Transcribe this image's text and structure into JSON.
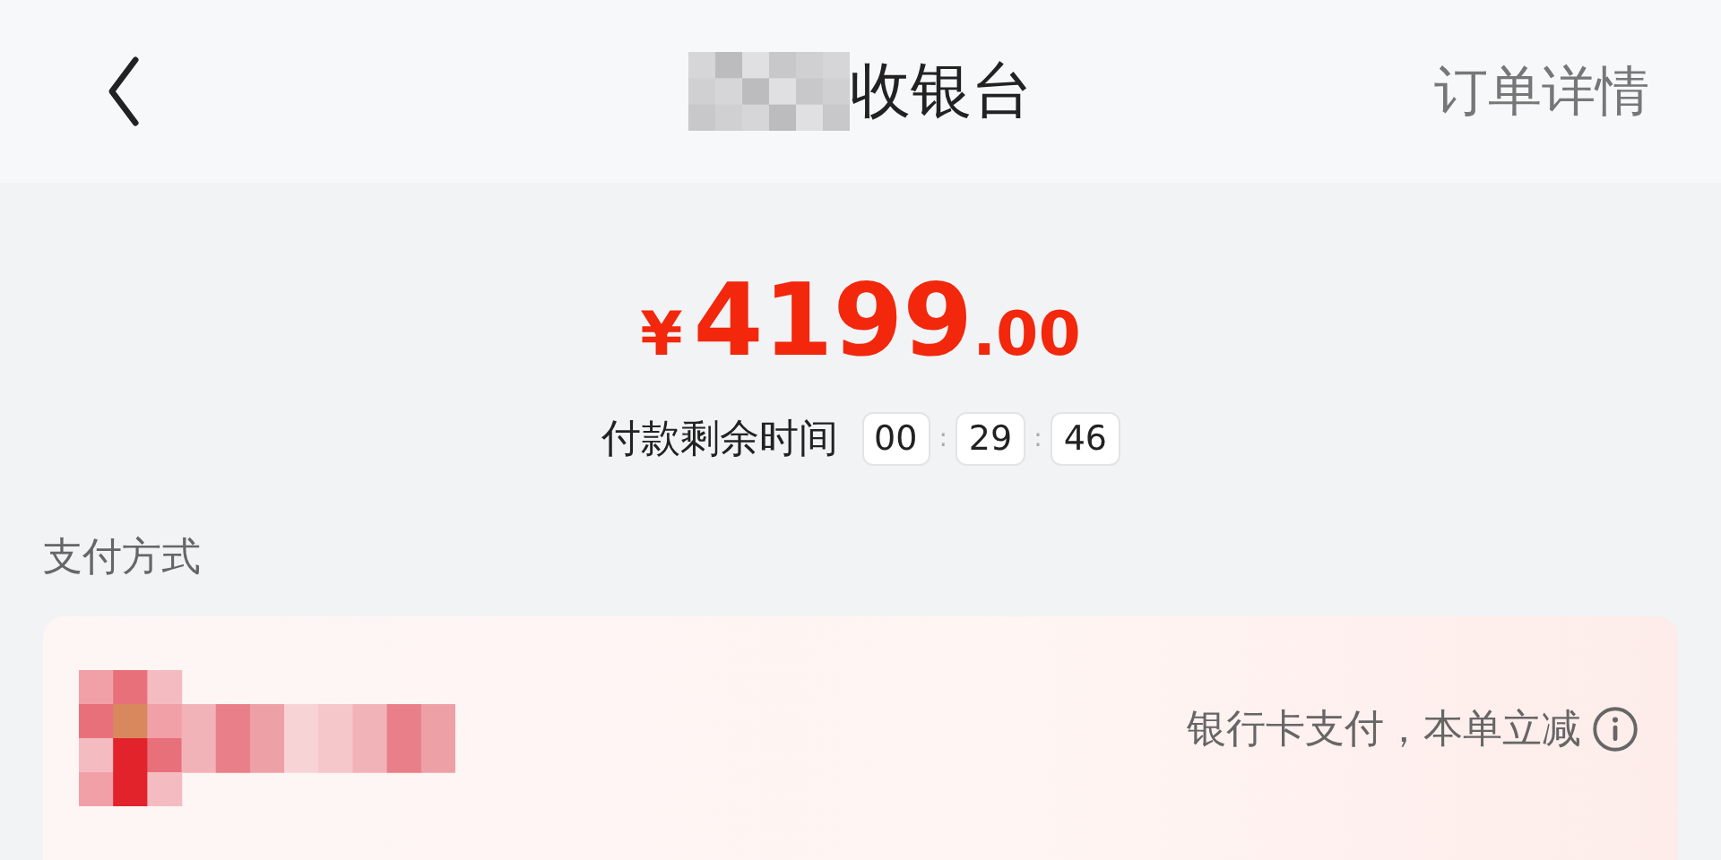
{
  "header": {
    "title": "收银台",
    "action": "订单详情"
  },
  "price": {
    "currency": "¥",
    "integer": "4199",
    "decimal": ".00"
  },
  "countdown": {
    "label": "付款剩余时间",
    "separator": ":",
    "segments": [
      "00",
      "29",
      "46"
    ]
  },
  "section_title": "支付方式",
  "payment_method": {
    "note": "银行卡支付，本单立减"
  }
}
